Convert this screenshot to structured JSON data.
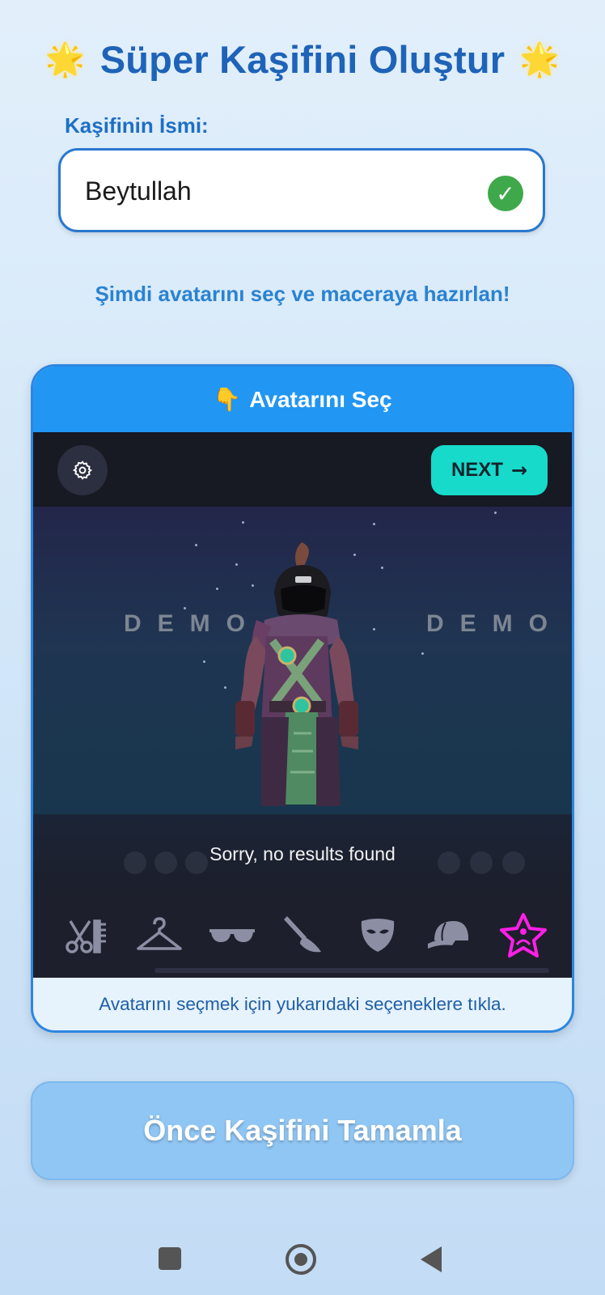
{
  "header": {
    "title": "Süper Kaşifini Oluştur",
    "star_left": "🌟",
    "star_right": "🌟"
  },
  "name_field": {
    "label": "Kaşifinin İsmi:",
    "value": "Beytullah",
    "valid_icon": "check-circle-icon"
  },
  "subtitle": "Şimdi avatarını seç ve maceraya hazırlan!",
  "avatar_card": {
    "heading_icon": "👇",
    "heading": "Avatarını Seç",
    "next_label": "NEXT",
    "next_arrow": "→",
    "watermark_left": "DEMO",
    "watermark_right": "DEMO",
    "empty_message": "Sorry, no results found",
    "categories": [
      "hair",
      "outfit",
      "glasses",
      "makeup",
      "mask",
      "hat",
      "favorites"
    ],
    "active_category": "favorites",
    "footer_hint": "Avatarını seçmek için yukarıdaki seçeneklere tıkla."
  },
  "cta_label": "Önce Kaşifini Tamamla",
  "colors": {
    "primary": "#2196f3",
    "title": "#1e63b8",
    "next_button": "#17dacb",
    "active_icon": "#ff1fe6",
    "valid": "#3fa84a"
  }
}
